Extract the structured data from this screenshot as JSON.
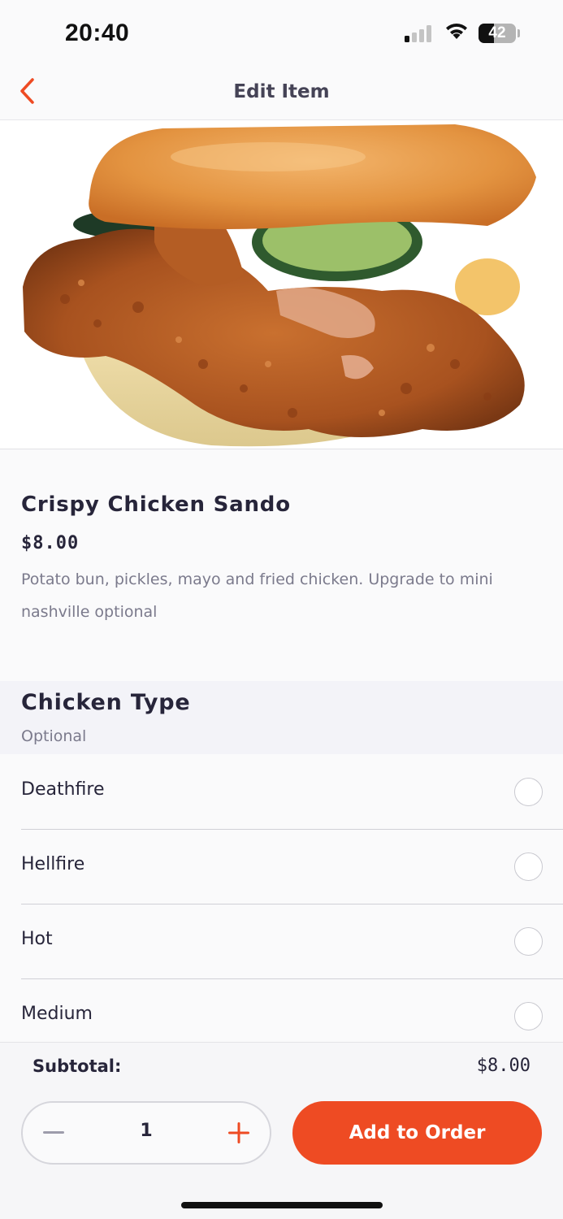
{
  "status": {
    "time": "20:40",
    "battery": "42",
    "battery_level": 0.42
  },
  "nav": {
    "title": "Edit Item",
    "back_icon": "chevron-left-icon"
  },
  "item": {
    "name": "Crispy Chicken Sando",
    "price": "$8.00",
    "description": "Potato bun, pickles, mayo and fried chicken. Upgrade to mini nashville optional"
  },
  "section": {
    "title": "Chicken Type",
    "subtitle": "Optional"
  },
  "options": [
    {
      "label": "Deathfire",
      "selected": false
    },
    {
      "label": "Hellfire",
      "selected": false
    },
    {
      "label": "Hot",
      "selected": false
    },
    {
      "label": "Medium",
      "selected": false
    }
  ],
  "footer": {
    "subtotal_label": "Subtotal:",
    "subtotal_value": "$8.00",
    "quantity": "1",
    "add_label": "Add to Order"
  },
  "colors": {
    "accent": "#ee4b23",
    "text": "#27253a",
    "muted": "#7b7a8c"
  }
}
